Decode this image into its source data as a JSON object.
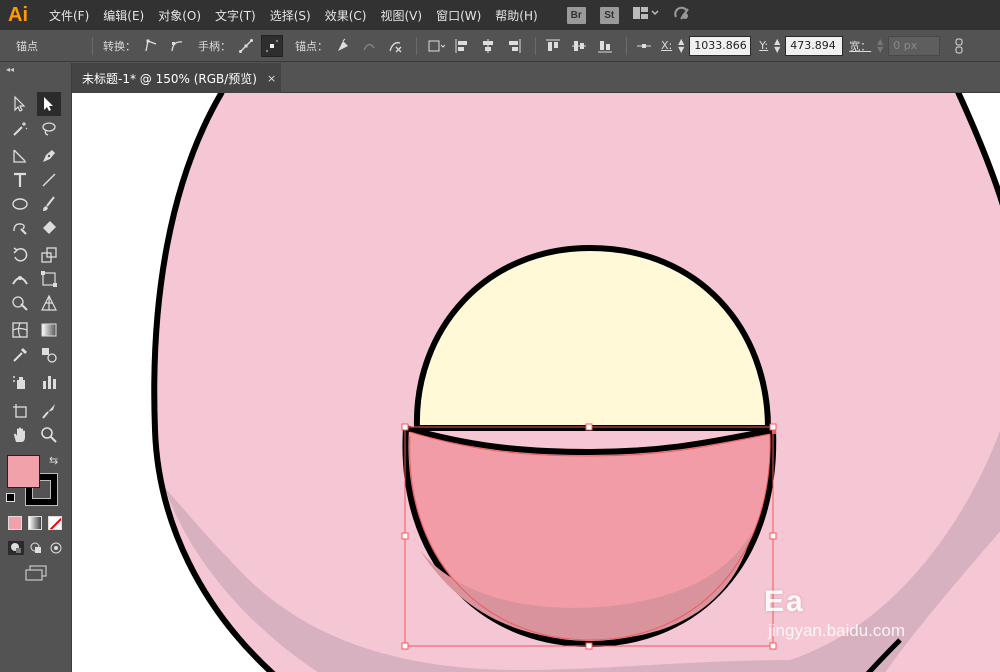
{
  "app": {
    "logo": "Ai",
    "accent": "#ff9a00"
  },
  "menu": {
    "items": [
      "文件(F)",
      "编辑(E)",
      "对象(O)",
      "文字(T)",
      "选择(S)",
      "效果(C)",
      "视图(V)",
      "窗口(W)",
      "帮助(H)"
    ],
    "bridge_label": "Br",
    "stock_label": "St",
    "workspace_icon": "layout-icon",
    "sync_icon": "sync-icon"
  },
  "control_bar": {
    "anchor_label": "锚点",
    "convert_label": "转换：",
    "handles_label": "手柄：",
    "anchors_label": "锚点：",
    "x_label": "X:",
    "x_value": "1033.866",
    "y_label": "Y:",
    "y_value": "473.894",
    "width_label": "宽：",
    "width_value": "0 px"
  },
  "document_tab": {
    "title": "未标题-1* @ 150% (RGB/预览)",
    "close": "×"
  },
  "tools_panel": {
    "collapse": "◂◂",
    "fill_color": "#f1a1aa",
    "stroke_color": "#000000",
    "selected_tool": "direct-selection"
  },
  "artwork": {
    "body_color": "#f5c6d3",
    "body_shadow_color": "#d7b1bf",
    "egg_color": "#fff9d8",
    "shell_color": "#f19ca6",
    "shell_shadow_color": "#d9939d",
    "outline_color": "#000000",
    "selection_color": "#f05a5a"
  },
  "watermark": {
    "main": "Ea",
    "sub": "jingyan.baidu.com"
  }
}
